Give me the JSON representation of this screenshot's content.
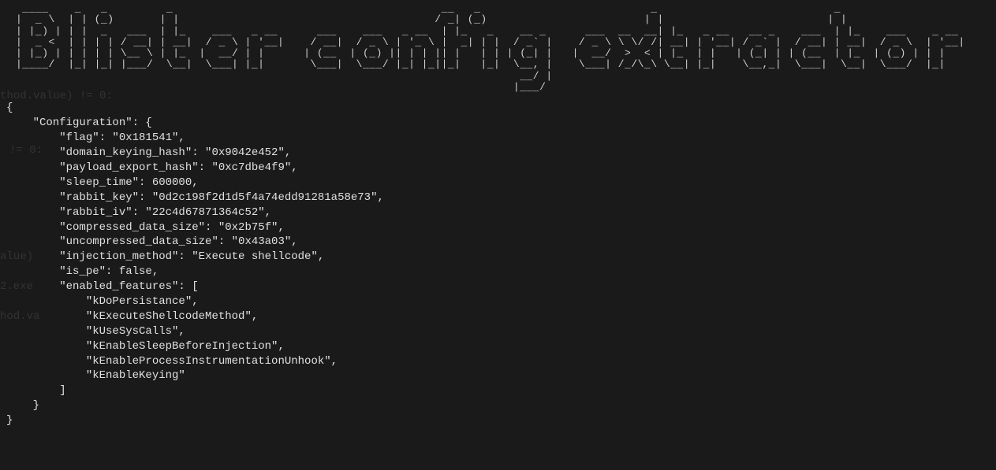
{
  "banner": {
    "lines": [
      " ____    _   _         _                                         __   _                          _                           _                  ",
      "|  _ \\  | | (_)       | |                                       / _| (_)                        | |                         | |                 ",
      "| |_) | | |  _   ___  | |_    ___   _ __      ___    ___   _ __  | |_   _    __ _      ___  __  __| |_   _ __   __ _    ___  | |_    ___    _ __ ",
      "|  _ <  | | | | / __| | __|  / _ \\ | '__|    / __|  / _ \\ | '_ \\ |  _| | |  / _` |    / _ \\ \\ \\/ /| __| | '__| / _` |  / __| | __|  / _ \\  | '__|",
      "| |_) | | | | | \\__ \\ | |_  |  __/ | |      | (__  | (_) || | | || |   | | | (_| |   |  __/  >  < | |_  | |   | (_| | | (__  | |_  | (_) | | |   ",
      "|____/  |_| |_| |___/  \\__|  \\___| |_|       \\___|  \\___/ |_| |_||_|   |_|  \\__, |    \\___| /_/\\_\\ \\__| |_|    \\__,_|  \\___|  \\__|  \\___/  |_|   ",
      "                                                                             __/ |                                                               ",
      "                                                                            |___/                                                                "
    ]
  },
  "ghost": {
    "line1": "thod.value) != 0:",
    "line2": "!= 0:",
    "line3": "alue)",
    "line4": "2.exe",
    "line5": "hod.va"
  },
  "output": {
    "configuration": {
      "flag": "0x181541",
      "domain_keying_hash": "0x9042e452",
      "payload_export_hash": "0xc7dbe4f9",
      "sleep_time": 600000,
      "rabbit_key": "0d2c198f2d1d5f4a74edd91281a58e73",
      "rabbit_iv": "22c4d67871364c52",
      "compressed_data_size": "0x2b75f",
      "uncompressed_data_size": "0x43a03",
      "injection_method": "Execute shellcode",
      "is_pe": false,
      "enabled_features": [
        "kDoPersistance",
        "kExecuteShellcodeMethod",
        "kUseSysCalls",
        "kEnableSleepBeforeInjection",
        "kEnableProcessInstrumentationUnhook",
        "kEnableKeying"
      ]
    }
  }
}
